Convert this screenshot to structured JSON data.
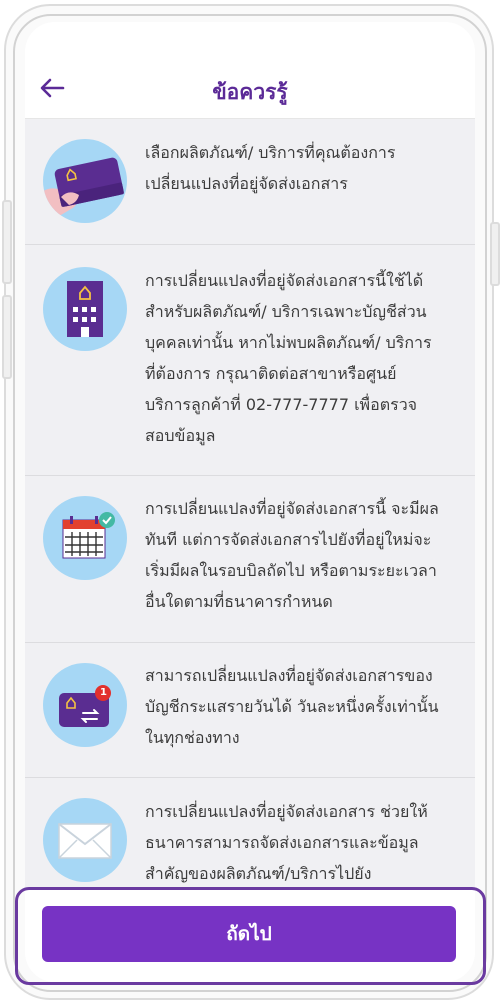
{
  "header": {
    "title": "ข้อควรรู้",
    "back_icon": "arrow-left-icon"
  },
  "items": [
    {
      "icon": "card-in-hand-icon",
      "text": "เลือกผลิตภัณฑ์/ บริการที่คุณต้องการเปลี่ยนแปลงที่อยู่จัดส่งเอกสาร"
    },
    {
      "icon": "bank-building-icon",
      "text": "การเปลี่ยนแปลงที่อยู่จัดส่งเอกสารนี้ใช้ได้สำหรับผลิตภัณฑ์/ บริการเฉพาะบัญชีส่วนบุคคลเท่านั้น หากไม่พบผลิตภัณฑ์/ บริการที่ต้องการ กรุณาติดต่อสาขาหรือศูนย์บริการลูกค้าที่ 02-777-7777 เพื่อตรวจสอบข้อมูล"
    },
    {
      "icon": "calendar-check-icon",
      "text": "การเปลี่ยนแปลงที่อยู่จัดส่งเอกสารนี้ จะมีผลทันที แต่การจัดส่งเอกสารไปยังที่อยู่ใหม่จะเริ่มมีผลในรอบบิลถัดไป หรือตามระยะเวลาอื่นใดตามที่ธนาคารกำหนด"
    },
    {
      "icon": "transfer-card-notification-icon",
      "badge": "1",
      "text": "สามารถเปลี่ยนแปลงที่อยู่จัดส่งเอกสารของบัญชีกระแสรายวันได้ วันละหนึ่งครั้งเท่านั้นในทุกช่องทาง"
    },
    {
      "icon": "envelope-icon",
      "text": "การเปลี่ยนแปลงที่อยู่จัดส่งเอกสาร ช่วยให้ธนาคารสามารถจัดส่งเอกสารและข้อมูลสำคัญของผลิตภัณฑ์/บริการไปยัง"
    }
  ],
  "footer": {
    "next_label": "ถัดไป"
  },
  "colors": {
    "accent": "#7733c4",
    "title": "#5b2a97",
    "icon_bg": "#a6d7f5"
  }
}
